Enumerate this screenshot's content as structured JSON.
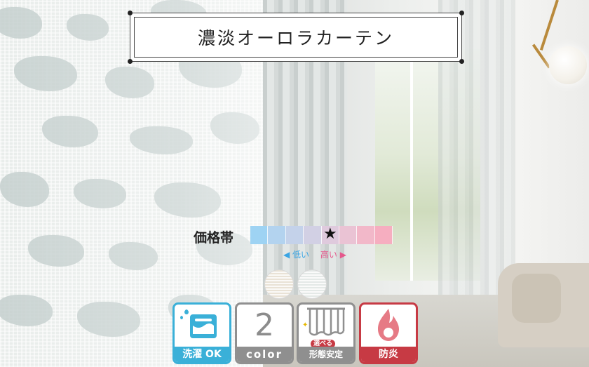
{
  "banner": {
    "title": "濃淡オーロラカーテン"
  },
  "price": {
    "label": "価格帯",
    "star": "★",
    "low_label": "◀ 低い",
    "high_label": "高い ▶",
    "segments": [
      "#9ed3f3",
      "#b3d3ef",
      "#c4d2ea",
      "#d2d0e4",
      "#dfcadd",
      "#eac3d4",
      "#f2b8c9",
      "#f6aec0"
    ]
  },
  "swatches": [
    {
      "name": "beige",
      "color": "#e9e2d6"
    },
    {
      "name": "gray",
      "color": "#e4e9e7"
    }
  ],
  "features": {
    "wash": {
      "label": "洗濯 OK",
      "icon": "washing-machine-icon",
      "color": "#3ab0d8"
    },
    "color": {
      "value": "2",
      "label": "color",
      "color": "#8f8f8f"
    },
    "shape": {
      "badge": "選べる",
      "label": "形態安定",
      "icon": "pleat-curtain-icon",
      "color": "#8f8f8f"
    },
    "fire": {
      "label": "防炎",
      "icon": "flame-icon",
      "color": "#c73a44"
    }
  }
}
